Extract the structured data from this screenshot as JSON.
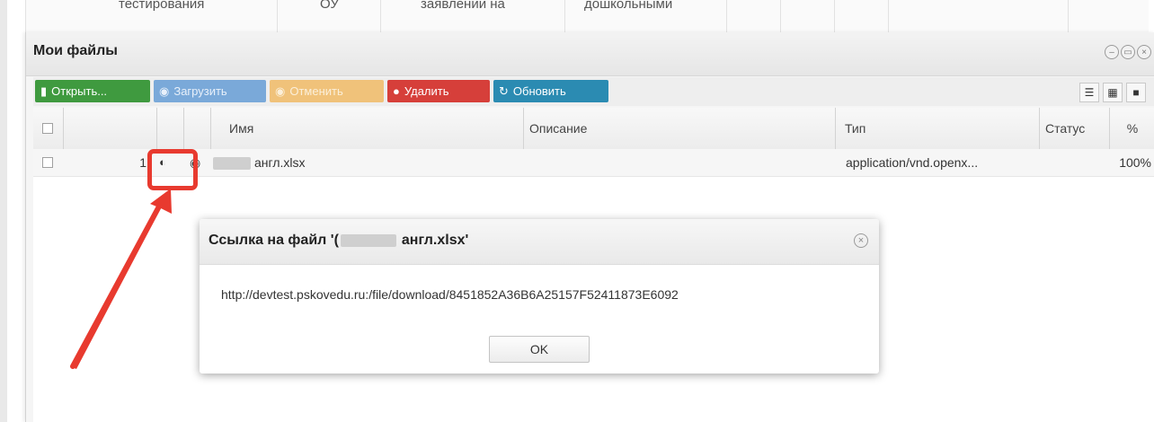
{
  "background_table": {
    "cells": [
      "тестирования",
      "ОУ",
      "заявлении на",
      "дошкольными"
    ]
  },
  "window": {
    "title": "Мои файлы",
    "controls": {
      "minimize_icon": "minimize-icon",
      "restore_icon": "restore-icon",
      "close_icon": "close-icon"
    }
  },
  "toolbar": {
    "open_label": "Открыть...",
    "upload_label": "Загрузить",
    "cancel_label": "Отменить",
    "delete_label": "Удалить",
    "refresh_label": "Обновить",
    "view_modes": [
      "list-view-icon",
      "grid-view-icon",
      "tiles-view-icon"
    ]
  },
  "grid": {
    "columns": {
      "name": "Имя",
      "description": "Описание",
      "type": "Тип",
      "status": "Статус",
      "percent": "%"
    },
    "rows": [
      {
        "index": "1",
        "name": "англ.xlsx",
        "description": "",
        "type": "application/vnd.openx...",
        "status": "",
        "percent": "100%"
      }
    ]
  },
  "dialog": {
    "title_prefix": "Ссылка на файл '(",
    "title_suffix": "англ.xlsx'",
    "link": "http://devtest.pskovedu.ru:/file/download/8451852A36B6A25157F52411873E6092",
    "ok_label": "OK"
  },
  "colors": {
    "open": "#3f9a3f",
    "upload": "#7aa9d9",
    "cancel": "#f0c27a",
    "delete": "#d63f3a",
    "refresh": "#2b8bb2",
    "highlight": "#e83a2f"
  }
}
